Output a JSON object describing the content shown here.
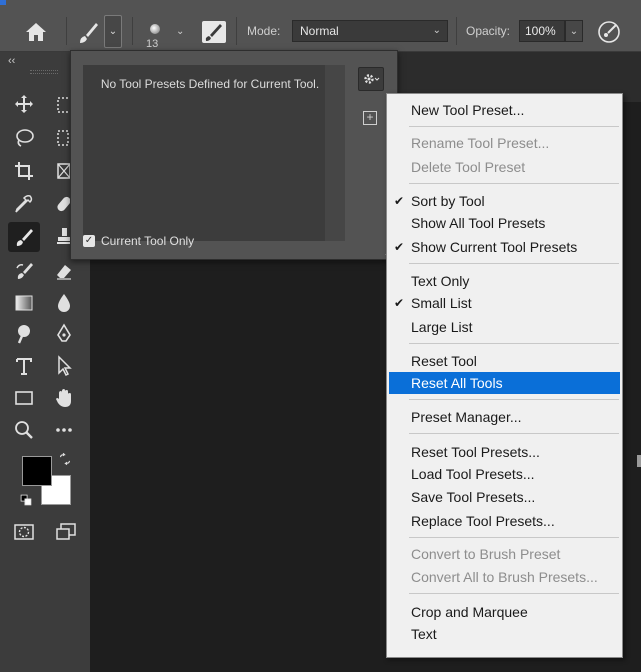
{
  "options_bar": {
    "brush_size": "13",
    "mode_label": "Mode:",
    "mode_value": "Normal",
    "opacity_label": "Opacity:",
    "opacity_value": "100%"
  },
  "presets_panel": {
    "empty_message": "No Tool Presets Defined for Current Tool.",
    "current_tool_only_label": "Current Tool Only",
    "current_tool_only_checked": true
  },
  "menu": {
    "items": [
      {
        "label": "New Tool Preset...",
        "enabled": true,
        "checked": false
      },
      {
        "label": "Rename Tool Preset...",
        "enabled": false,
        "checked": false
      },
      {
        "label": "Delete Tool Preset",
        "enabled": false,
        "checked": false
      },
      {
        "label": "Sort by Tool",
        "enabled": true,
        "checked": true
      },
      {
        "label": "Show All Tool Presets",
        "enabled": true,
        "checked": false
      },
      {
        "label": "Show Current Tool Presets",
        "enabled": true,
        "checked": true
      },
      {
        "label": "Text Only",
        "enabled": true,
        "checked": false
      },
      {
        "label": "Small List",
        "enabled": true,
        "checked": true
      },
      {
        "label": "Large List",
        "enabled": true,
        "checked": false
      },
      {
        "label": "Reset Tool",
        "enabled": true,
        "checked": false
      },
      {
        "label": "Reset All Tools",
        "enabled": true,
        "checked": false,
        "highlighted": true
      },
      {
        "label": "Preset Manager...",
        "enabled": true,
        "checked": false
      },
      {
        "label": "Reset Tool Presets...",
        "enabled": true,
        "checked": false
      },
      {
        "label": "Load Tool Presets...",
        "enabled": true,
        "checked": false
      },
      {
        "label": "Save Tool Presets...",
        "enabled": true,
        "checked": false
      },
      {
        "label": "Replace Tool Presets...",
        "enabled": true,
        "checked": false
      },
      {
        "label": "Convert to Brush Preset",
        "enabled": false,
        "checked": false
      },
      {
        "label": "Convert All to Brush Presets...",
        "enabled": false,
        "checked": false
      },
      {
        "label": "Crop and Marquee",
        "enabled": true,
        "checked": false
      },
      {
        "label": "Text",
        "enabled": true,
        "checked": false
      }
    ]
  },
  "colors": {
    "foreground": "#000000",
    "background": "#ffffff",
    "highlight": "#0a6fd8"
  }
}
